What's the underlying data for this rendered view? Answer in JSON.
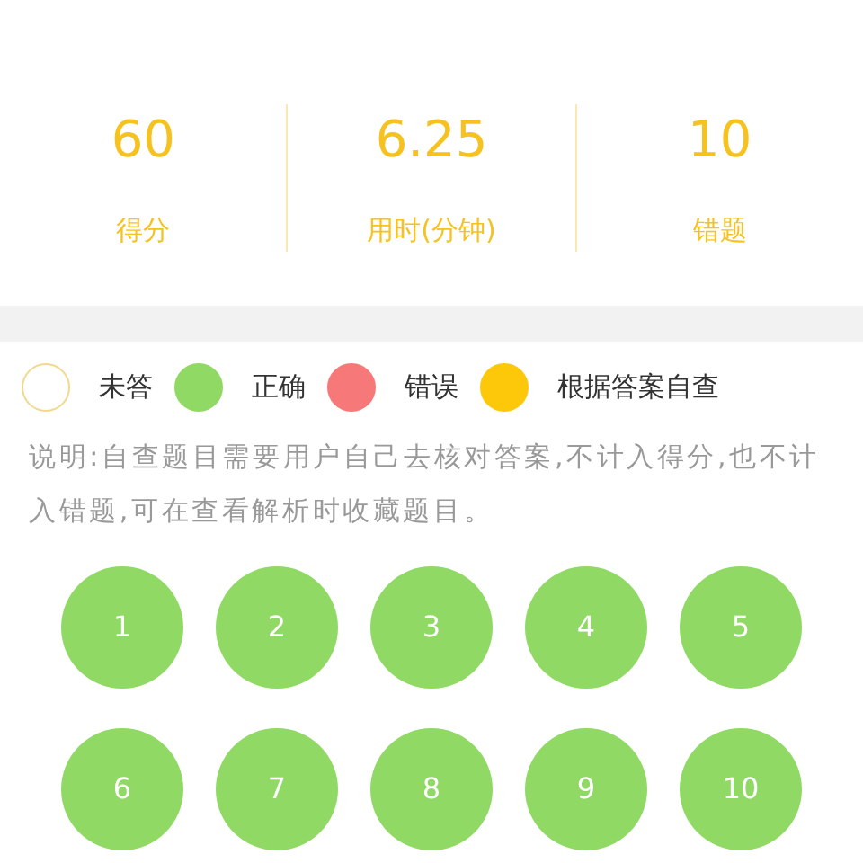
{
  "stats": [
    {
      "value": "60",
      "label": "得分"
    },
    {
      "value": "6.25",
      "label": "用时(分钟)"
    },
    {
      "value": "10",
      "label": "错题"
    }
  ],
  "legend": [
    {
      "label": "未答",
      "color": "#ffffff"
    },
    {
      "label": "正确",
      "color": "#8fd964"
    },
    {
      "label": "错误",
      "color": "#f77878"
    },
    {
      "label": "根据答案自查",
      "color": "#fdc80a"
    }
  ],
  "note": "说明:自查题目需要用户自己去核对答案,不计入得分,也不计入错题,可在查看解析时收藏题目。",
  "questions": [
    {
      "number": "1",
      "color": "#8fd964"
    },
    {
      "number": "2",
      "color": "#8fd964"
    },
    {
      "number": "3",
      "color": "#8fd964"
    },
    {
      "number": "4",
      "color": "#8fd964"
    },
    {
      "number": "5",
      "color": "#8fd964"
    },
    {
      "number": "6",
      "color": "#8fd964"
    },
    {
      "number": "7",
      "color": "#8fd964"
    },
    {
      "number": "8",
      "color": "#8fd964"
    },
    {
      "number": "9",
      "color": "#8fd964"
    },
    {
      "number": "10",
      "color": "#8fd964"
    }
  ]
}
